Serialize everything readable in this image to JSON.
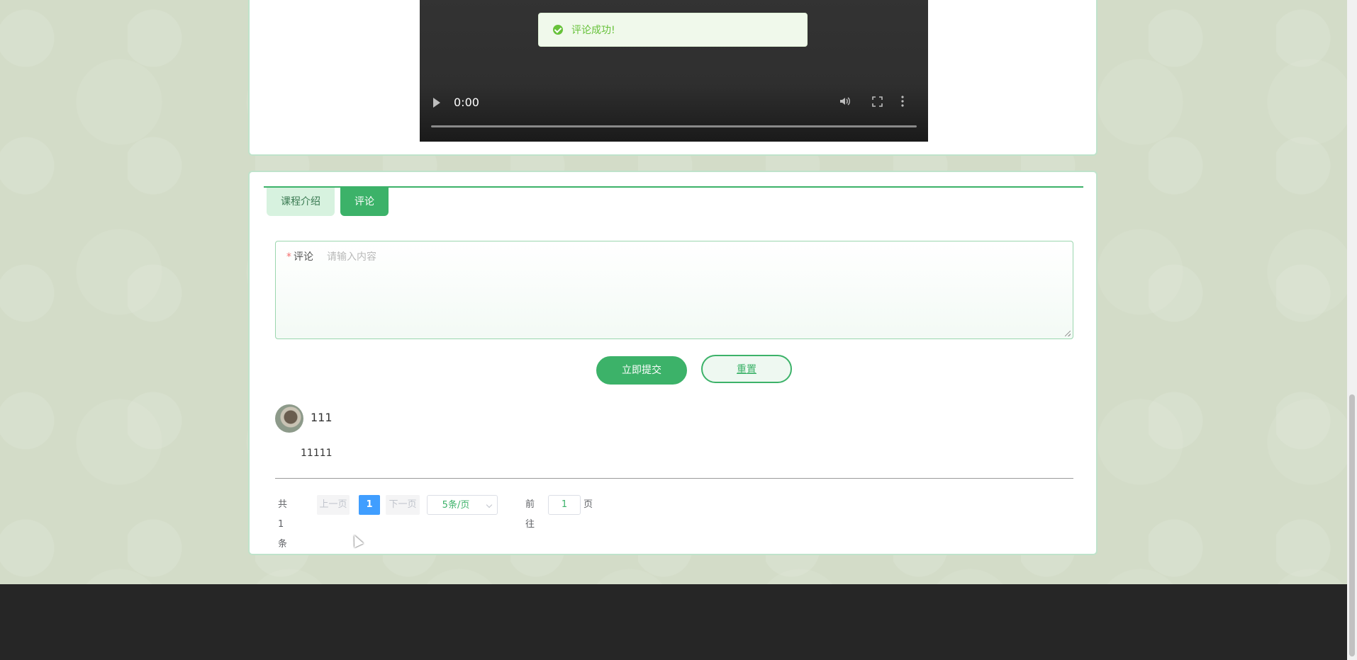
{
  "video": {
    "time": "0:00",
    "progress_fraction": 0,
    "controls": [
      "play-icon",
      "volume-icon",
      "fullscreen-icon",
      "more-icon"
    ]
  },
  "toast": {
    "text": "评论成功!",
    "type": "success",
    "icon": "check-circle-icon"
  },
  "tabs": [
    {
      "label": "课程介绍",
      "active": false
    },
    {
      "label": "评论",
      "active": true
    }
  ],
  "form": {
    "label": "评论",
    "required_mark": "*",
    "placeholder": "请输入内容",
    "value": "",
    "submit_label": "立即提交",
    "reset_label": "重置"
  },
  "comments": [
    {
      "user": "111",
      "content": "11111",
      "avatar": "user-avatar"
    }
  ],
  "pagination": {
    "total_text": "共 1 条",
    "prev_label": "上一页",
    "current_page": "1",
    "next_label": "下一页",
    "page_size": "5条/页",
    "goto_label": "前往",
    "goto_value": "1",
    "page_unit": "页"
  },
  "colors": {
    "accent": "#3cb269",
    "page_bg": "#d3dcc8",
    "footer_bg": "#262626",
    "toast_text": "#67c23a",
    "active_page": "#409eff"
  }
}
